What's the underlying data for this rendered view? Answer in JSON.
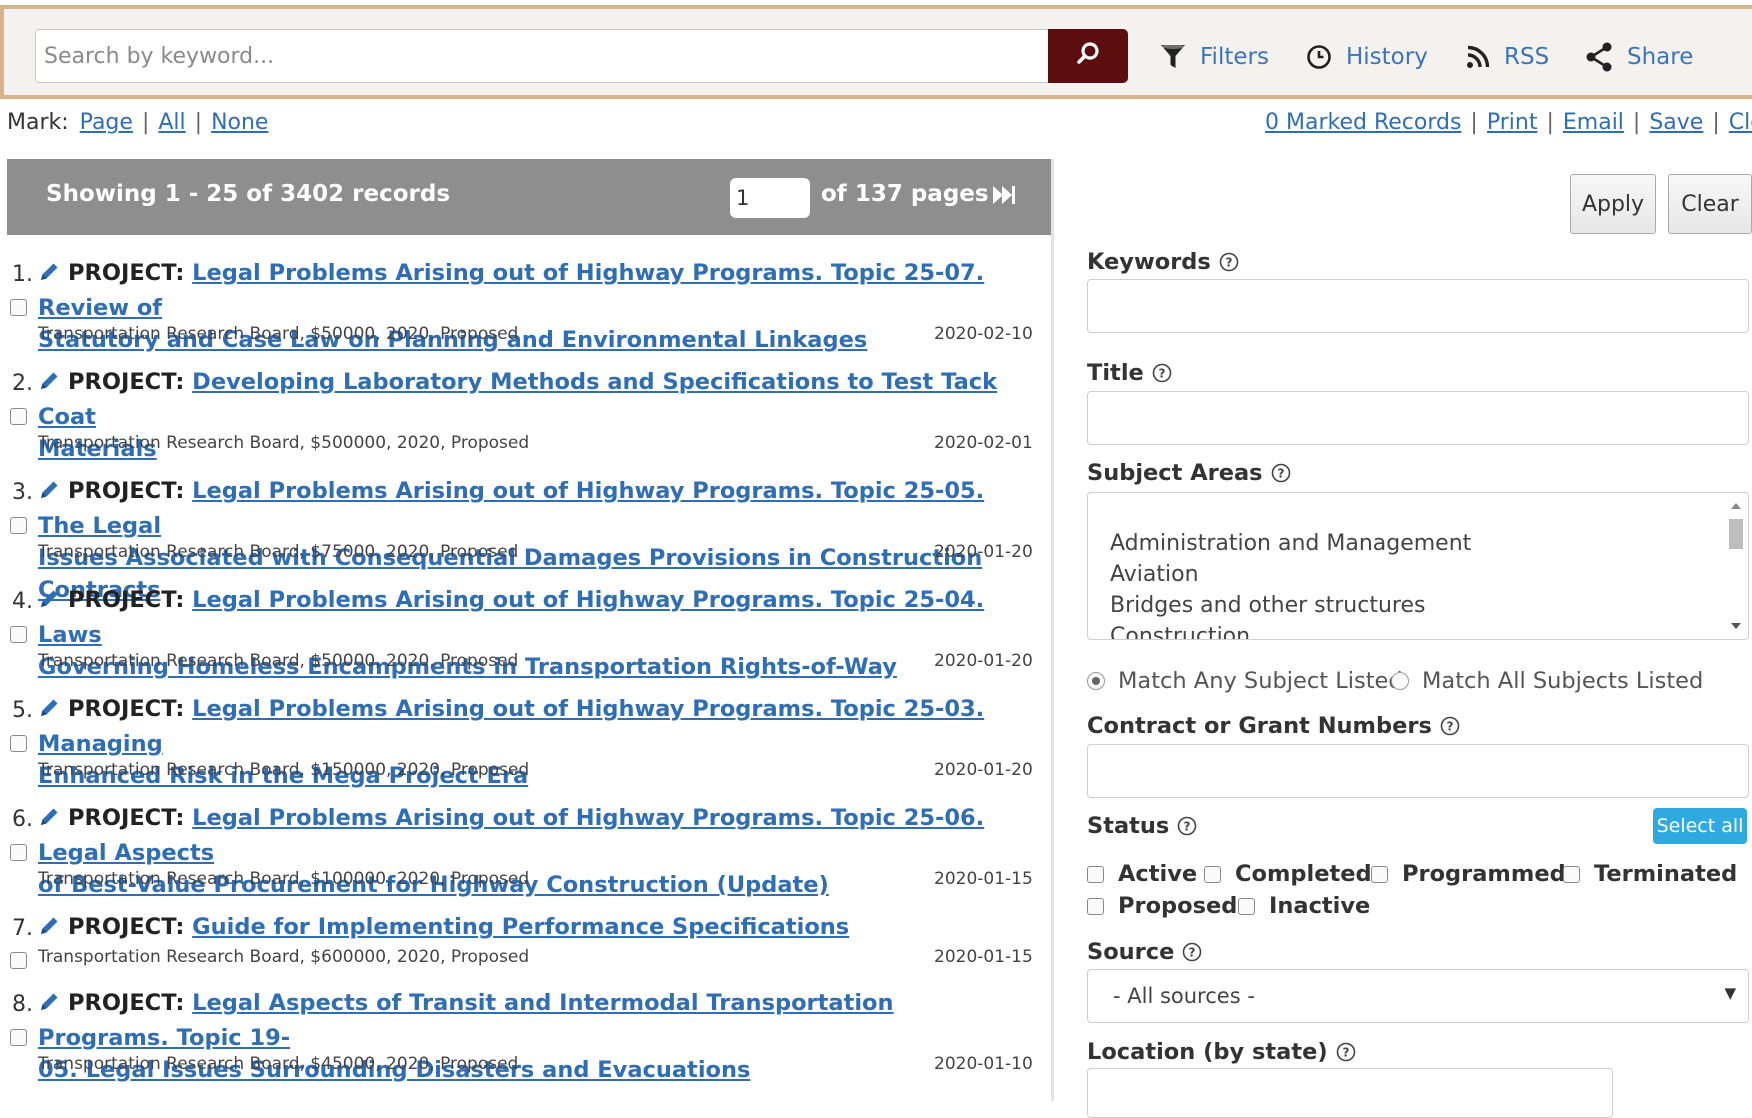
{
  "search": {
    "placeholder": "Search by keyword..."
  },
  "toolbar": {
    "filters": "Filters",
    "history": "History",
    "rss": "RSS",
    "share": "Share"
  },
  "mark": {
    "label": "Mark:",
    "page": "Page",
    "all": "All",
    "none": "None"
  },
  "actions": {
    "marked_records": "0 Marked Records",
    "print": "Print",
    "email": "Email",
    "save": "Save",
    "clear": "Clear"
  },
  "results": {
    "showing": "Showing 1 - 25 of 3402 records",
    "page_value": "1",
    "of_pages": "of 137 pages",
    "records": [
      {
        "num": "1.",
        "type": "PROJECT:",
        "title_l1": "Legal Problems Arising out of Highway Programs. Topic 25-07. Review of",
        "title_l2": "Statutory and Case Law on Planning and Environmental Linkages",
        "meta": "Transportation Research Board, $50000, 2020, Proposed",
        "date": "2020-02-10"
      },
      {
        "num": "2.",
        "type": "PROJECT:",
        "title_l1": "Developing Laboratory Methods and Specifications to Test Tack Coat",
        "title_l2": "Materials",
        "meta": "Transportation Research Board, $500000, 2020, Proposed",
        "date": "2020-02-01"
      },
      {
        "num": "3.",
        "type": "PROJECT:",
        "title_l1": "Legal Problems Arising out of Highway Programs. Topic 25-05. The Legal",
        "title_l2": "Issues Associated with Consequential Damages Provisions in Construction Contracts",
        "meta": "Transportation Research Board, $75000, 2020, Proposed",
        "date": "2020-01-20"
      },
      {
        "num": "4.",
        "type": "PROJECT:",
        "title_l1": "Legal Problems Arising out of Highway Programs. Topic 25-04. Laws",
        "title_l2": "Governing Homeless Encampments in Transportation Rights-of-Way",
        "meta": "Transportation Research Board, $50000, 2020, Proposed",
        "date": "2020-01-20"
      },
      {
        "num": "5.",
        "type": "PROJECT:",
        "title_l1": "Legal Problems Arising out of Highway Programs. Topic 25-03. Managing",
        "title_l2": "Enhanced Risk in the Mega Project Era",
        "meta": "Transportation Research Board, $150000, 2020, Proposed",
        "date": "2020-01-20"
      },
      {
        "num": "6.",
        "type": "PROJECT:",
        "title_l1": "Legal Problems Arising out of Highway Programs. Topic 25-06. Legal Aspects",
        "title_l2": "of Best-Value Procurement for Highway Construction (Update)",
        "meta": "Transportation Research Board, $100000, 2020, Proposed",
        "date": "2020-01-15"
      },
      {
        "num": "7.",
        "type": "PROJECT:",
        "title_l1": "Guide for Implementing Performance Specifications",
        "title_l2": "",
        "meta": "Transportation Research Board, $600000, 2020, Proposed",
        "date": "2020-01-15"
      },
      {
        "num": "8.",
        "type": "PROJECT:",
        "title_l1": "Legal Aspects of Transit and Intermodal Transportation Programs. Topic 19-",
        "title_l2": "05. Legal Issues Surrounding Disasters and Evacuations",
        "meta": "Transportation Research Board, $45000, 2020, Proposed",
        "date": "2020-01-10"
      }
    ]
  },
  "filters": {
    "apply": "Apply",
    "clear": "Clear",
    "keywords": "Keywords",
    "title": "Title",
    "subject_areas": "Subject Areas",
    "subject_options": [
      "Administration and Management",
      "Aviation",
      "Bridges and other structures",
      "Construction"
    ],
    "match_any": "Match Any Subject Listed",
    "match_all": "Match All Subjects Listed",
    "contract": "Contract or Grant Numbers",
    "status": "Status",
    "select_all": "Select all",
    "status_options": [
      "Active",
      "Completed",
      "Programmed",
      "Terminated",
      "Proposed",
      "Inactive"
    ],
    "source": "Source",
    "source_value": "- All sources -",
    "location": "Location (by state)"
  },
  "colors": {
    "link": "#2f6db5",
    "search_button": "#5a0e0e",
    "header_gray": "#8e8e8e",
    "select_all": "#2eaae0",
    "topbar_border": "#d7b48d"
  }
}
